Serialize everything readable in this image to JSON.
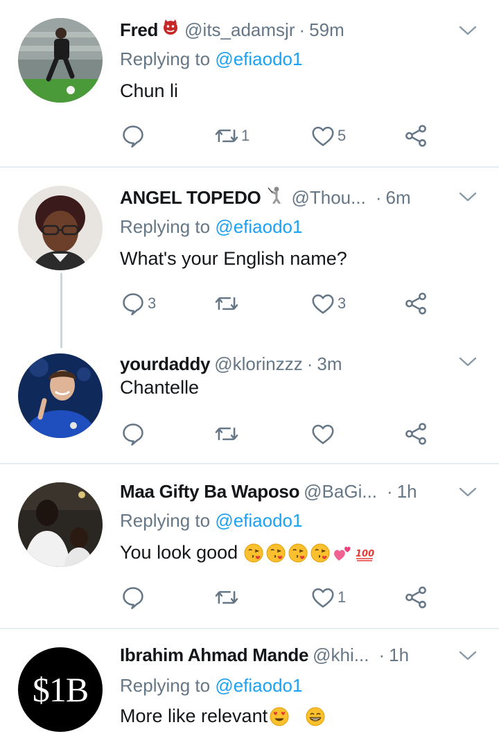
{
  "tweets": [
    {
      "name": "Fred",
      "handle": "@its_adamsjr",
      "time": "59m",
      "replying_prefix": "Replying to",
      "replying_to": "@efiaodo1",
      "text": "Chun li",
      "reply_count": "",
      "retweet_count": "1",
      "like_count": "5"
    },
    {
      "name": "ANGEL TOPEDO",
      "handle": "@Thou...",
      "time": "6m",
      "replying_prefix": "Replying to",
      "replying_to": "@efiaodo1",
      "text": "What's your English name?",
      "reply_count": "3",
      "retweet_count": "",
      "like_count": "3"
    },
    {
      "name": "yourdaddy",
      "handle": "@klorinzzz",
      "time": "3m",
      "text": "Chantelle",
      "reply_count": "",
      "retweet_count": "",
      "like_count": ""
    },
    {
      "name": "Maa Gifty Ba Waposo",
      "handle": "@BaGi...",
      "time": "1h",
      "replying_prefix": "Replying to",
      "replying_to": "@efiaodo1",
      "text": "You look good",
      "reply_count": "",
      "retweet_count": "",
      "like_count": "1"
    },
    {
      "name": "Ibrahim Ahmad Mande",
      "handle": "@khi...",
      "time": "1h",
      "replying_prefix": "Replying to",
      "replying_to": "@efiaodo1",
      "text": "More like relevant",
      "avatar_text": "$1B"
    }
  ],
  "separator": "·",
  "icons": {
    "reply": "reply-icon",
    "retweet": "retweet-icon",
    "like": "heart-icon",
    "share": "share-icon",
    "menu": "chevron-down-icon"
  },
  "colors": {
    "text": "#14171a",
    "muted": "#657786",
    "link": "#1da1f2",
    "divider": "#e6ecf0"
  }
}
